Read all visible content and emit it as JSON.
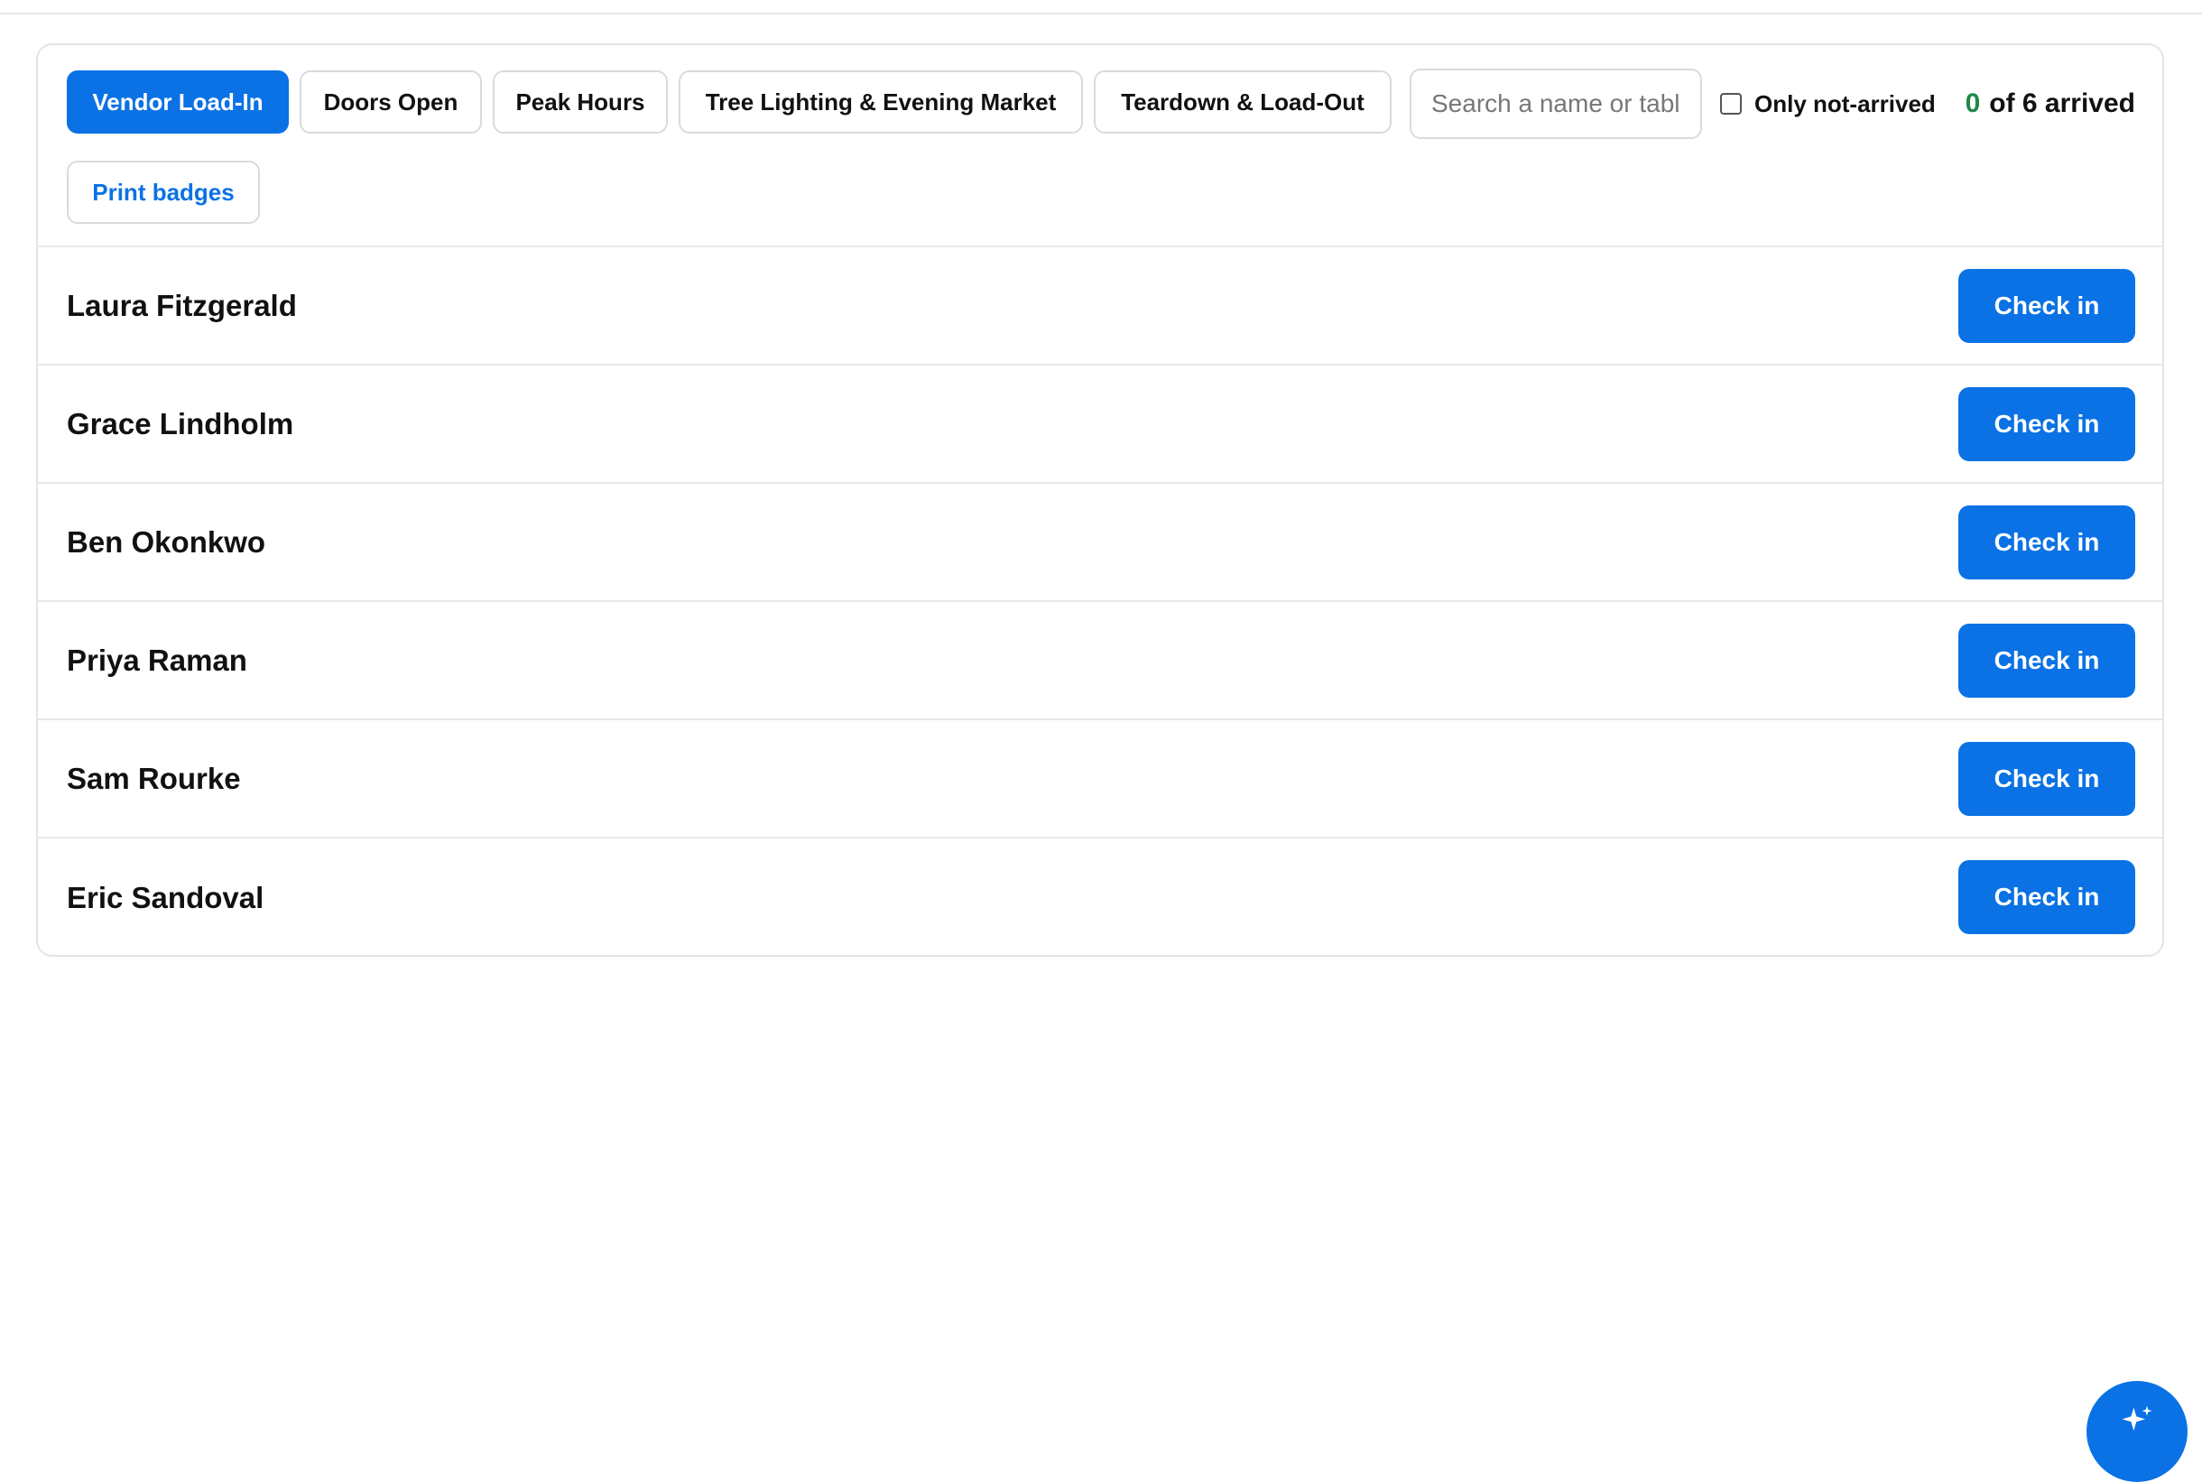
{
  "tabs": [
    {
      "label": "Vendor Load-In",
      "active": true
    },
    {
      "label": "Doors Open",
      "active": false
    },
    {
      "label": "Peak Hours",
      "active": false
    },
    {
      "label": "Tree Lighting & Evening Market",
      "active": false
    },
    {
      "label": "Teardown & Load-Out",
      "active": false
    }
  ],
  "search": {
    "placeholder": "Search a name or table",
    "value": ""
  },
  "filter": {
    "label": "Only not-arrived",
    "checked": false
  },
  "counter": {
    "arrived": "0",
    "suffix": "of 6 arrived"
  },
  "print_label": "Print badges",
  "attendees": [
    {
      "name": "Laura Fitzgerald",
      "action": "Check in"
    },
    {
      "name": "Grace Lindholm",
      "action": "Check in"
    },
    {
      "name": "Ben Okonkwo",
      "action": "Check in"
    },
    {
      "name": "Priya Raman",
      "action": "Check in"
    },
    {
      "name": "Sam Rourke",
      "action": "Check in"
    },
    {
      "name": "Eric Sandoval",
      "action": "Check in"
    }
  ],
  "colors": {
    "accent": "#0a72e4",
    "arrived_count": "#1d8a4a"
  },
  "fab_icon": "sparkle-icon"
}
